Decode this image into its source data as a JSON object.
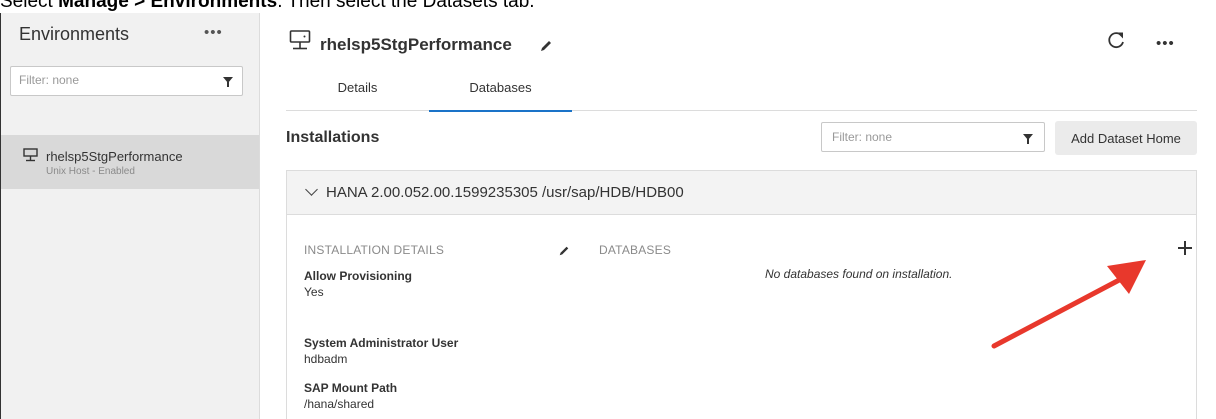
{
  "caption": {
    "prefix": "Select ",
    "bold1": "Manage > Environments",
    "suffix": ". Then select the Datasets tab."
  },
  "sidebar": {
    "title": "Environments",
    "more": "•••",
    "filter_placeholder": "Filter: none",
    "items": [
      {
        "name": "rhelsp5StgPerformance",
        "status": "Unix Host - Enabled"
      }
    ]
  },
  "header": {
    "title": "rhelsp5StgPerformance",
    "more": "•••"
  },
  "tabs": [
    {
      "label": "Details"
    },
    {
      "label": "Databases",
      "active": true
    }
  ],
  "installations": {
    "title": "Installations",
    "filter_placeholder": "Filter: none",
    "add_button": "Add Dataset Home",
    "panel_title": "HANA 2.00.052.00.1599235305 /usr/sap/HDB/HDB00",
    "details_label": "INSTALLATION DETAILS",
    "databases_label": "DATABASES",
    "no_databases": "No databases found on installation.",
    "fields": [
      {
        "label": "Allow Provisioning",
        "value": "Yes"
      },
      {
        "label": "System Administrator User",
        "value": "hdbadm"
      },
      {
        "label": "SAP Mount Path",
        "value": "/hana/shared"
      }
    ]
  },
  "colors": {
    "accent": "#1a73c8",
    "arrow": "#e8382c",
    "sidebar_bg": "#f1f1f1",
    "selected_item": "#d9d9d9"
  }
}
